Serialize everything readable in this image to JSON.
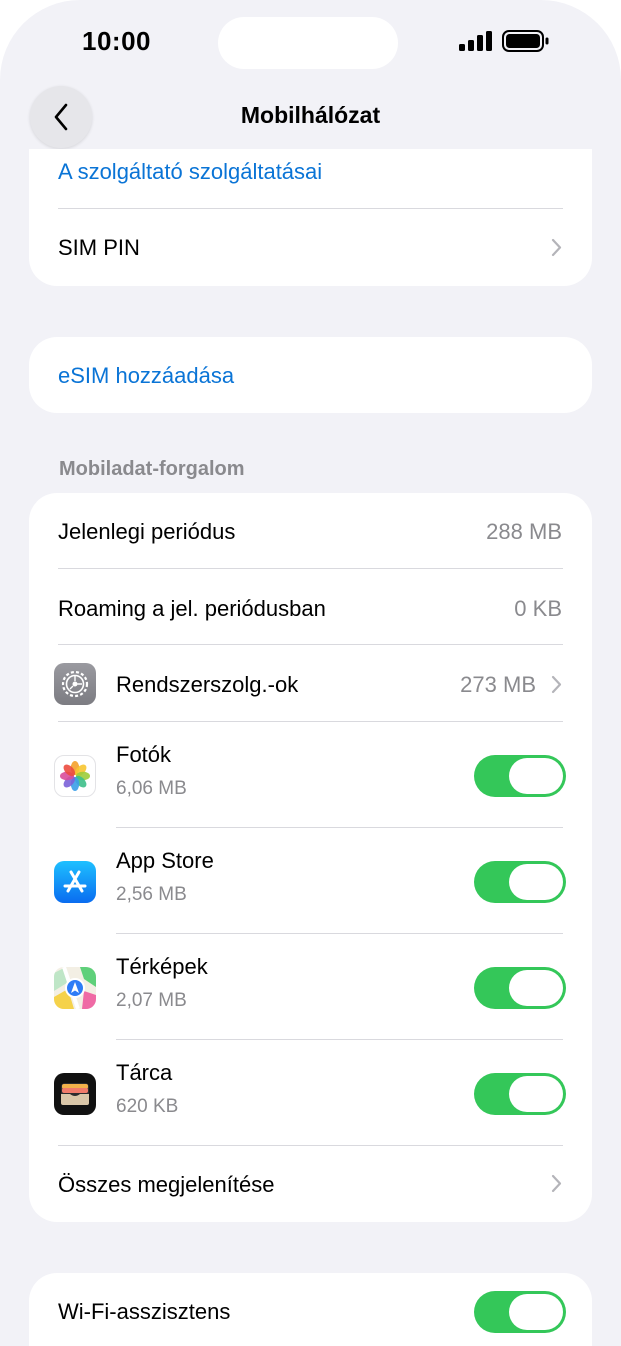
{
  "status_bar": {
    "time": "10:00"
  },
  "nav": {
    "title": "Mobilhálózat"
  },
  "carrier_group": {
    "carrier_services": "A szolgáltató szolgáltatásai",
    "sim_pin": "SIM PIN"
  },
  "esim": {
    "add_label": "eSIM hozzáadása"
  },
  "data_section": {
    "header": "Mobiladat-forgalom",
    "current_period": {
      "label": "Jelenlegi periódus",
      "value": "288 MB"
    },
    "roaming_period": {
      "label": "Roaming a jel. periódusban",
      "value": "0 KB"
    },
    "system_services": {
      "label": "Rendszerszolg.-ok",
      "value": "273 MB"
    },
    "apps": [
      {
        "name": "Fotók",
        "usage": "6,06 MB",
        "enabled": true,
        "icon": "photos-icon"
      },
      {
        "name": "App Store",
        "usage": "2,56 MB",
        "enabled": true,
        "icon": "app-store-icon"
      },
      {
        "name": "Térképek",
        "usage": "2,07 MB",
        "enabled": true,
        "icon": "maps-icon"
      },
      {
        "name": "Tárca",
        "usage": "620 KB",
        "enabled": true,
        "icon": "wallet-icon"
      }
    ],
    "show_all": "Összes megjelenítése"
  },
  "wifi_assist": {
    "label": "Wi-Fi-asszisztens",
    "enabled": true
  },
  "colors": {
    "accent": "#0a74d6",
    "toggle_on": "#34c759",
    "background": "#f2f2f7"
  }
}
